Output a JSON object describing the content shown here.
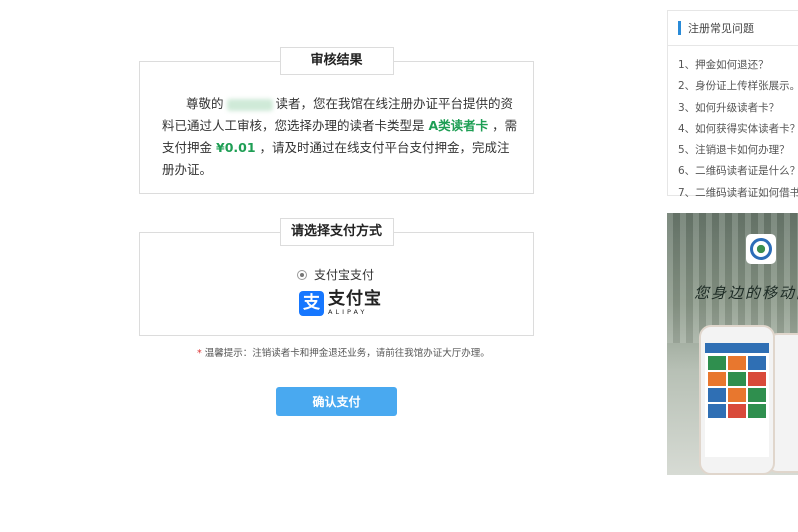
{
  "review": {
    "title": "审核结果",
    "greeting_prefix": "尊敬的",
    "text_part1": "读者，您在我馆在线注册办证平台提供的资料已通过人工审核，您选择办理的读者卡类型是",
    "card_type": "A类读者卡",
    "text_part2": "，需支付押金",
    "deposit": "¥0.01",
    "text_part3": "，请及时通过在线支付平台支付押金，完成注册办证。"
  },
  "payment": {
    "title": "请选择支付方式",
    "option_label": "支付宝支付",
    "alipay_mark": "支",
    "alipay_cn": "支付宝",
    "alipay_en": "ALIPAY"
  },
  "notice": {
    "star": "*",
    "text": "温馨提示：注销读者卡和押金退还业务，请前往我馆办证大厅办理。"
  },
  "confirm_button": "确认支付",
  "faq": {
    "title": "注册常见问题",
    "items": [
      "1、押金如何退还？",
      "2、身份证上传样张展示。",
      "3、如何升级读者卡？",
      "4、如何获得实体读者卡？",
      "5、注销退卡如何办理？",
      "6、二维码读者证是什么？",
      "7、二维码读者证如何借书"
    ]
  },
  "promo": {
    "slogan": "您身边的移动图"
  },
  "colors": {
    "highlight": "#1e9e54",
    "button": "#49a9f0",
    "alipay_blue": "#1677ff",
    "faq_accent": "#2a8bd8"
  }
}
